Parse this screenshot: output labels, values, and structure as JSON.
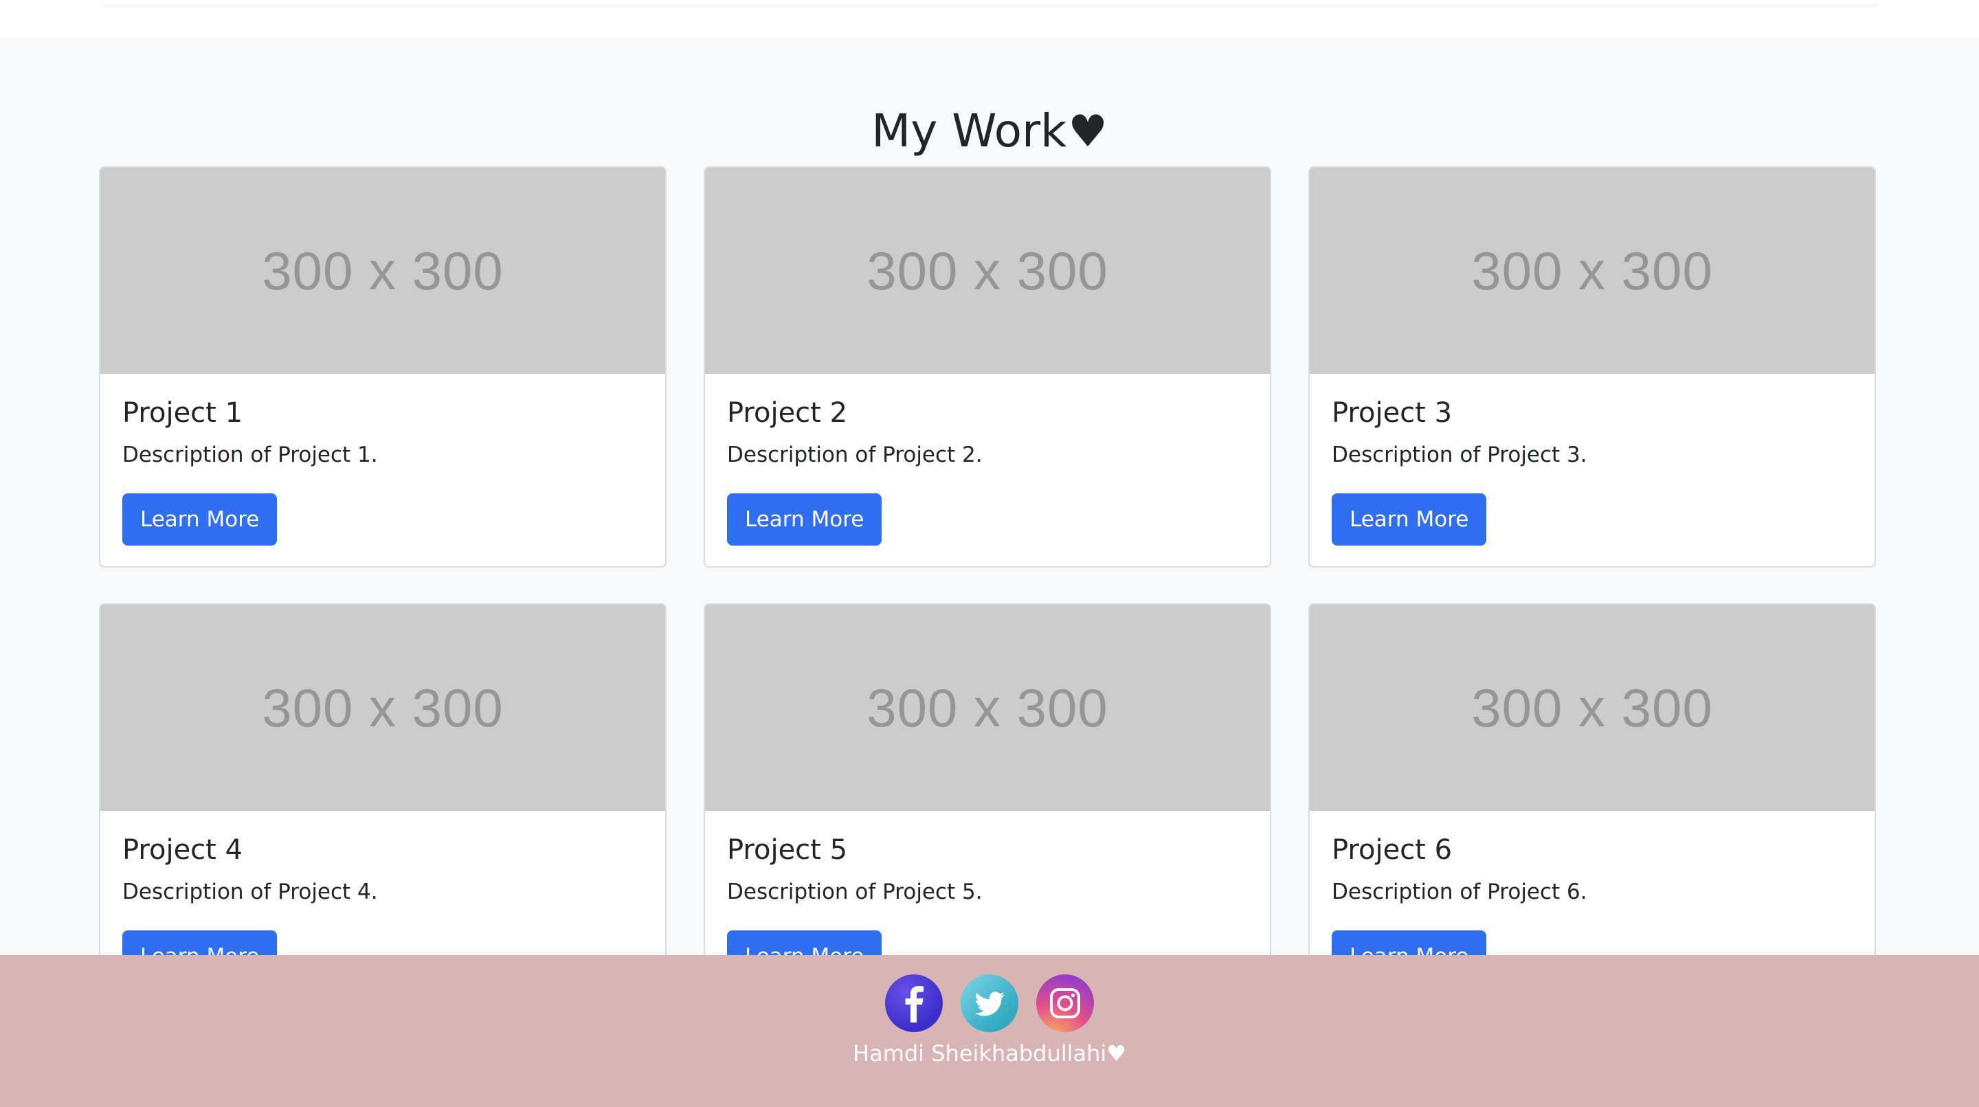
{
  "section": {
    "title": "My Work",
    "title_icon": "heart-icon"
  },
  "cards": [
    {
      "image_text": "300 x 300",
      "title": "Project 1",
      "description": "Description of Project 1.",
      "button": "Learn More"
    },
    {
      "image_text": "300 x 300",
      "title": "Project 2",
      "description": "Description of Project 2.",
      "button": "Learn More"
    },
    {
      "image_text": "300 x 300",
      "title": "Project 3",
      "description": "Description of Project 3.",
      "button": "Learn More"
    },
    {
      "image_text": "300 x 300",
      "title": "Project 4",
      "description": "Description of Project 4.",
      "button": "Learn More"
    },
    {
      "image_text": "300 x 300",
      "title": "Project 5",
      "description": "Description of Project 5.",
      "button": "Learn More"
    },
    {
      "image_text": "300 x 300",
      "title": "Project 6",
      "description": "Description of Project 6.",
      "button": "Learn More"
    }
  ],
  "footer": {
    "social_icons": [
      "facebook-icon",
      "twitter-icon",
      "instagram-icon"
    ],
    "credit": "Hamdi Sheikhabdullahi",
    "credit_icon": "heart-icon"
  },
  "colors": {
    "button": "#2f6ef0",
    "footer_bg": "#d9b4b4",
    "section_bg": "#f8f9fa",
    "placeholder_bg": "#cccccc"
  }
}
